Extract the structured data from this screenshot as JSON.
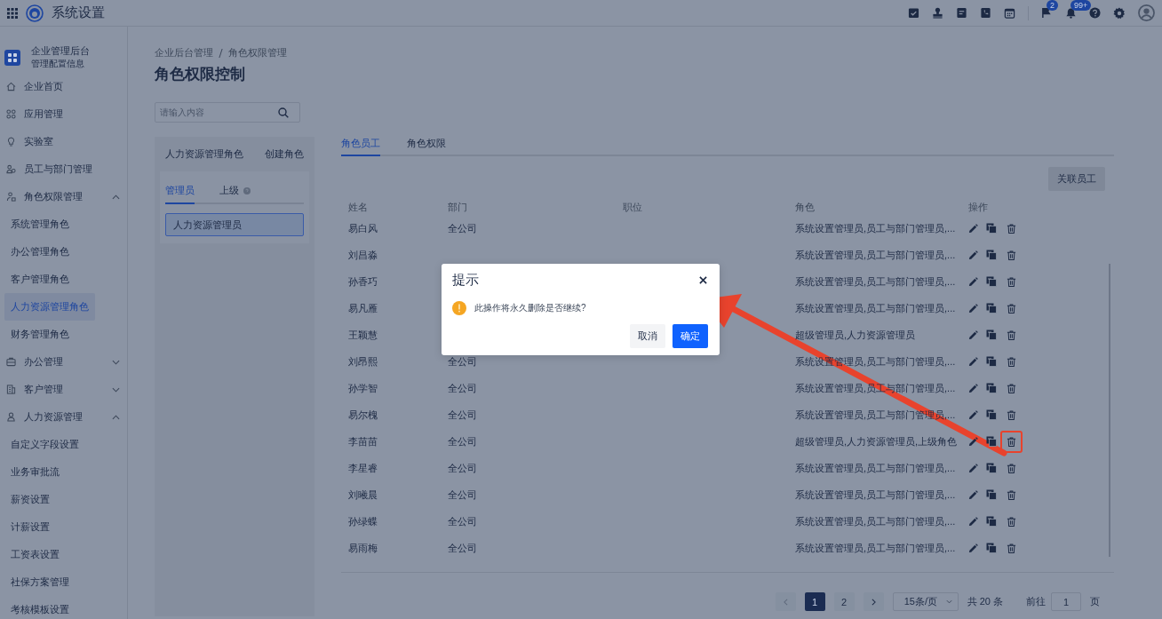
{
  "topbar": {
    "title": "系统设置",
    "notifications": [
      {
        "kind": "flag",
        "badge": "2"
      },
      {
        "kind": "bell",
        "badge": "99+"
      }
    ]
  },
  "sidebar": {
    "brand": {
      "title": "企业管理后台",
      "subtitle": "管理配置信息"
    },
    "items": [
      {
        "label": "企业首页",
        "selected": false
      },
      {
        "label": "应用管理",
        "selected": false
      },
      {
        "label": "实验室",
        "selected": false
      },
      {
        "label": "员工与部门管理",
        "selected": false
      },
      {
        "label": "角色权限管理",
        "selected": false,
        "expanded": true,
        "children": [
          {
            "label": "系统管理角色",
            "selected": false
          },
          {
            "label": "办公管理角色",
            "selected": false
          },
          {
            "label": "客户管理角色",
            "selected": false
          },
          {
            "label": "人力资源管理角色",
            "selected": true
          },
          {
            "label": "财务管理角色",
            "selected": false
          }
        ]
      },
      {
        "label": "办公管理",
        "selected": false,
        "expanded": false
      },
      {
        "label": "客户管理",
        "selected": false,
        "expanded": false
      },
      {
        "label": "人力资源管理",
        "selected": false,
        "expanded": true,
        "children": [
          {
            "label": "自定义字段设置",
            "selected": false
          },
          {
            "label": "业务审批流",
            "selected": false
          },
          {
            "label": "薪资设置",
            "selected": false
          },
          {
            "label": "计薪设置",
            "selected": false
          },
          {
            "label": "工资表设置",
            "selected": false
          },
          {
            "label": "社保方案管理",
            "selected": false
          },
          {
            "label": "考核模板设置",
            "selected": false
          }
        ]
      }
    ]
  },
  "breadcrumb": [
    "企业后台管理",
    "角色权限管理"
  ],
  "page_title": "角色权限控制",
  "search": {
    "placeholder": "请输入内容"
  },
  "role_panel": {
    "title": "人力资源管理角色",
    "action": "创建角色",
    "tabs": [
      {
        "label": "管理员",
        "selected": true,
        "help": false
      },
      {
        "label": "上级",
        "selected": false,
        "help": true
      }
    ],
    "roles": [
      {
        "label": "人力资源管理员",
        "selected": true
      }
    ]
  },
  "tabs": [
    {
      "label": "角色员工",
      "selected": true
    },
    {
      "label": "角色权限",
      "selected": false
    }
  ],
  "link_button": "关联员工",
  "table": {
    "columns": [
      "姓名",
      "部门",
      "职位",
      "角色",
      "操作"
    ],
    "rows": [
      {
        "name": "易白风",
        "dept": "全公司",
        "role": "系统设置管理员,员工与部门管理员,...",
        "highlighted": false
      },
      {
        "name": "刘昌淼",
        "role": "系统设置管理员,员工与部门管理员,...",
        "highlighted": false
      },
      {
        "name": "孙香巧",
        "role": "系统设置管理员,员工与部门管理员,...",
        "highlighted": false
      },
      {
        "name": "易凡雁",
        "role": "系统设置管理员,员工与部门管理员,...",
        "highlighted": false
      },
      {
        "name": "王颖慧",
        "role": "超级管理员,人力资源管理员",
        "highlighted": false
      },
      {
        "name": "刘昂熙",
        "dept": "全公司",
        "role": "系统设置管理员,员工与部门管理员,...",
        "highlighted": false
      },
      {
        "name": "孙学智",
        "dept": "全公司",
        "role": "系统设置管理员,员工与部门管理员,...",
        "highlighted": false
      },
      {
        "name": "易尔槐",
        "dept": "全公司",
        "role": "系统设置管理员,员工与部门管理员,...",
        "highlighted": false
      },
      {
        "name": "李苗苗",
        "dept": "全公司",
        "role": "超级管理员,人力资源管理员,上级角色",
        "highlighted": true
      },
      {
        "name": "李星睿",
        "dept": "全公司",
        "role": "系统设置管理员,员工与部门管理员,...",
        "highlighted": false
      },
      {
        "name": "刘曦晨",
        "dept": "全公司",
        "role": "系统设置管理员,员工与部门管理员,...",
        "highlighted": false
      },
      {
        "name": "孙绿蝶",
        "dept": "全公司",
        "role": "系统设置管理员,员工与部门管理员,...",
        "highlighted": false
      },
      {
        "name": "易雨梅",
        "dept": "全公司",
        "role": "系统设置管理员,员工与部门管理员,...",
        "highlighted": false
      }
    ]
  },
  "pagination": {
    "pages": [
      {
        "label": "1",
        "selected": true
      },
      {
        "label": "2",
        "selected": false
      }
    ],
    "page_size": "15条/页",
    "total": "共 20 条",
    "goto_label": "前往",
    "goto_value": "1",
    "goto_unit": "页"
  },
  "dialog": {
    "title": "提示",
    "message": "此操作将永久删除是否继续?",
    "buttons": [
      {
        "label": "取消",
        "kind": "cancel"
      },
      {
        "label": "确定",
        "kind": "confirm"
      }
    ]
  }
}
